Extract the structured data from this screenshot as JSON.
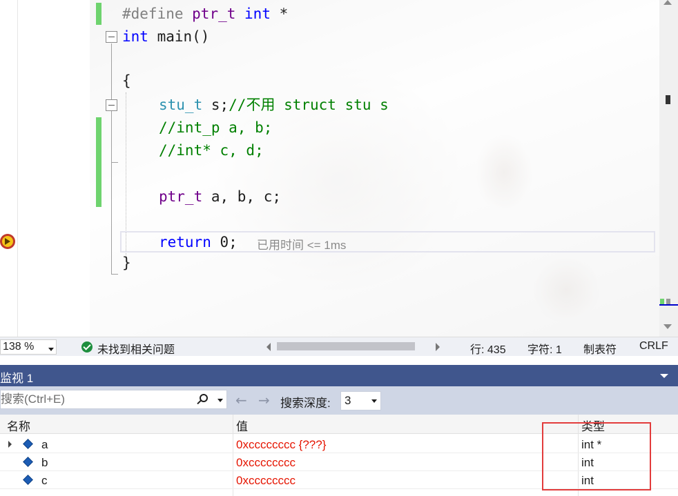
{
  "editor": {
    "lines": [
      {
        "id": "define",
        "tokens": [
          [
            "pp",
            "#define "
          ],
          [
            "mac",
            "ptr_t"
          ],
          [
            "pp",
            " "
          ],
          [
            "kw",
            "int"
          ],
          [
            "tx",
            " *"
          ]
        ]
      },
      {
        "id": "main",
        "tokens": [
          [
            "kw",
            "int"
          ],
          [
            "tx",
            " main()"
          ]
        ]
      },
      {
        "id": "open-brace",
        "tokens": [
          [
            "tx",
            "{"
          ]
        ]
      },
      {
        "id": "stu-decl",
        "tokens": [
          [
            "ty",
            "stu_t"
          ],
          [
            "tx",
            " s;"
          ],
          [
            "cm",
            "//不用 struct stu s"
          ]
        ]
      },
      {
        "id": "comment-intp",
        "tokens": [
          [
            "cm",
            "//int_p a, b;"
          ]
        ]
      },
      {
        "id": "comment-intstar",
        "tokens": [
          [
            "cm",
            "//int* c, d;"
          ]
        ]
      },
      {
        "id": "ptr-decl",
        "tokens": [
          [
            "mac",
            "ptr_t"
          ],
          [
            "tx",
            " a, b, c;"
          ]
        ]
      },
      {
        "id": "return",
        "tokens": [
          [
            "kw",
            "return"
          ],
          [
            "tx",
            " 0;"
          ]
        ]
      },
      {
        "id": "close-brace",
        "tokens": [
          [
            "tx",
            "}"
          ]
        ]
      }
    ],
    "elapsed_hint": "已用时间 <= 1ms"
  },
  "status_bar": {
    "zoom": "138 %",
    "issues": "未找到相关问题",
    "line": "行: 435",
    "char": "字符: 1",
    "tabs": "制表符",
    "eol": "CRLF"
  },
  "watch": {
    "title": "监视 1",
    "search_placeholder": "搜索(Ctrl+E)",
    "back_arrow": "←",
    "forward_arrow": "→",
    "depth_label": "搜索深度:",
    "depth_value": "3",
    "columns": {
      "name": "名称",
      "value": "值",
      "type": "类型"
    },
    "rows": [
      {
        "name": "a",
        "value": "0xcccccccc {???}",
        "type": "int *",
        "expandable": true
      },
      {
        "name": "b",
        "value": "0xcccccccc",
        "type": "int",
        "expandable": false
      },
      {
        "name": "c",
        "value": "0xcccccccc",
        "type": "int",
        "expandable": false
      }
    ]
  },
  "colors": {
    "keyword": "#0000ff",
    "macro": "#6f008a",
    "type": "#2b91af",
    "comment": "#008000",
    "watch_value": "#e51400",
    "watch_title_bar": "#40568d",
    "annotation_box": "#e23b3b"
  }
}
